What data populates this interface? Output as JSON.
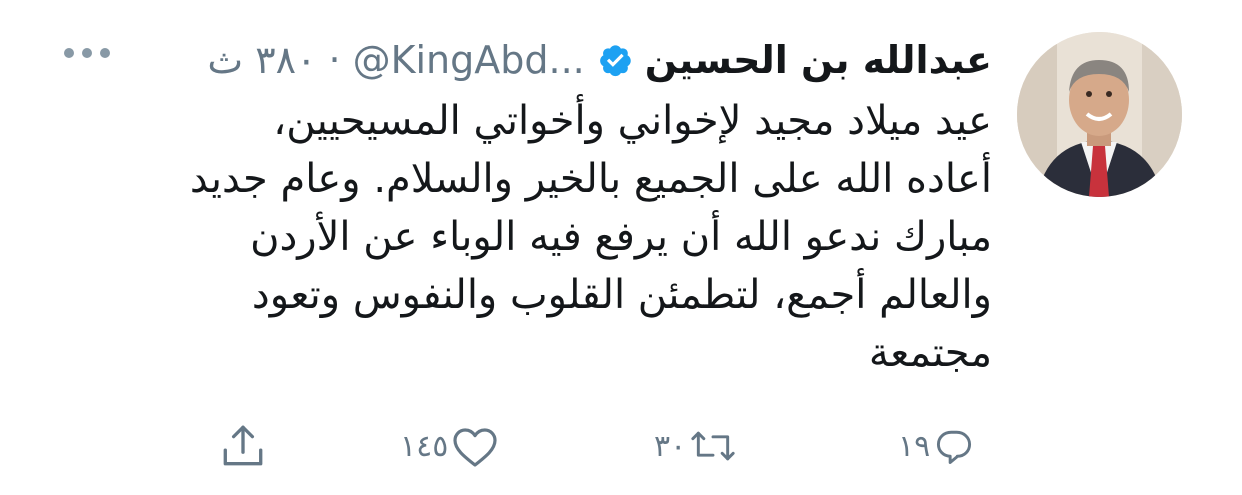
{
  "tweet": {
    "author": {
      "name": "عبدالله بن الحسين",
      "handle": "@KingAbd...",
      "verified": true
    },
    "time_ago": "٣٨٠ ث",
    "separator": "·",
    "text_lines": [
      "عيد ميلاد مجيد لإخواني وأخواتي المسيحيين،",
      "أعاده الله على الجميع بالخير والسلام. وعام جديد",
      "مبارك ندعو الله أن يرفع فيه الوباء عن الأردن",
      "والعالم أجمع، لتطمئن القلوب والنفوس وتعود",
      "مجتمعة"
    ],
    "actions": {
      "reply": {
        "icon": "reply-icon",
        "count": "١٩"
      },
      "retweet": {
        "icon": "retweet-icon",
        "count": "٣٠"
      },
      "like": {
        "icon": "heart-icon",
        "count": "١٤٥"
      },
      "share": {
        "icon": "share-icon"
      }
    }
  },
  "colors": {
    "text": "#14171a",
    "secondary": "#657786",
    "verified": "#1da1f2"
  }
}
